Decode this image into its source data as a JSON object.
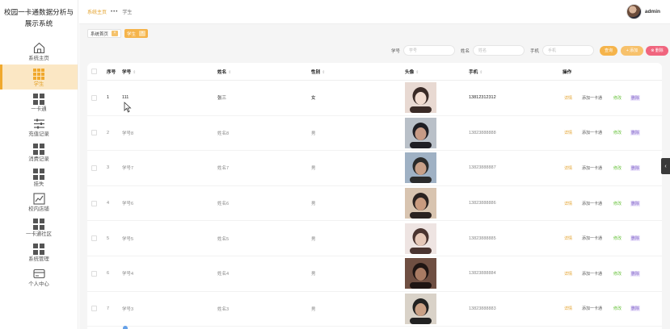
{
  "sidebar": {
    "title": "校园一卡通数据分析与展示系统",
    "items": [
      {
        "label": "系统主页",
        "icon": "home-icon"
      },
      {
        "label": "学生",
        "icon": "grid-icon",
        "active": true
      },
      {
        "label": "一卡通",
        "icon": "grid-icon"
      },
      {
        "label": "充值记录",
        "icon": "sliders-icon"
      },
      {
        "label": "消费记录",
        "icon": "grid-icon"
      },
      {
        "label": "挂失",
        "icon": "grid-icon"
      },
      {
        "label": "校内店铺",
        "icon": "chart-icon"
      },
      {
        "label": "一卡通社区",
        "icon": "grid-icon"
      },
      {
        "label": "系统管理",
        "icon": "grid-icon"
      },
      {
        "label": "个人中心",
        "icon": "card-icon"
      }
    ]
  },
  "header": {
    "breadcrumb_home": "系统主页",
    "breadcrumb_sep": "•••",
    "breadcrumb_current": "学生",
    "user_name": "admin"
  },
  "tabs": [
    {
      "label": "系统首页",
      "close": "×"
    },
    {
      "label": "学生",
      "close": "×"
    }
  ],
  "search": {
    "fields": [
      {
        "label": "学号",
        "placeholder": "学号"
      },
      {
        "label": "姓名",
        "placeholder": "姓名"
      },
      {
        "label": "手机",
        "placeholder": "手机"
      }
    ],
    "search_button": "查询",
    "add_button": "+ 添加",
    "delete_button": "⊗ 删除"
  },
  "table": {
    "columns": [
      "序号",
      "学号",
      "姓名",
      "性别",
      "头像",
      "手机",
      "操作"
    ],
    "actions": {
      "detail": "详情",
      "add_card": "添加一卡通",
      "edit": "修改",
      "delete": "删除"
    },
    "rows": [
      {
        "index": "1",
        "student_id": "111",
        "name": "张三",
        "gender": "女",
        "phone": "13812312312"
      },
      {
        "index": "2",
        "student_id": "学号8",
        "name": "姓名8",
        "gender": "男",
        "phone": "13823888888"
      },
      {
        "index": "3",
        "student_id": "学号7",
        "name": "姓名7",
        "gender": "男",
        "phone": "13823888887"
      },
      {
        "index": "4",
        "student_id": "学号6",
        "name": "姓名6",
        "gender": "男",
        "phone": "13823888886"
      },
      {
        "index": "5",
        "student_id": "学号5",
        "name": "姓名5",
        "gender": "男",
        "phone": "13823888885"
      },
      {
        "index": "6",
        "student_id": "学号4",
        "name": "姓名4",
        "gender": "男",
        "phone": "13823888884"
      },
      {
        "index": "7",
        "student_id": "学号3",
        "name": "姓名3",
        "gender": "男",
        "phone": "13823888883"
      }
    ]
  },
  "colors": {
    "accent": "#f5b44b",
    "danger": "#f0657e",
    "edit": "#67c23a",
    "delete": "#7b5cc7"
  },
  "side_toggle": "‹"
}
